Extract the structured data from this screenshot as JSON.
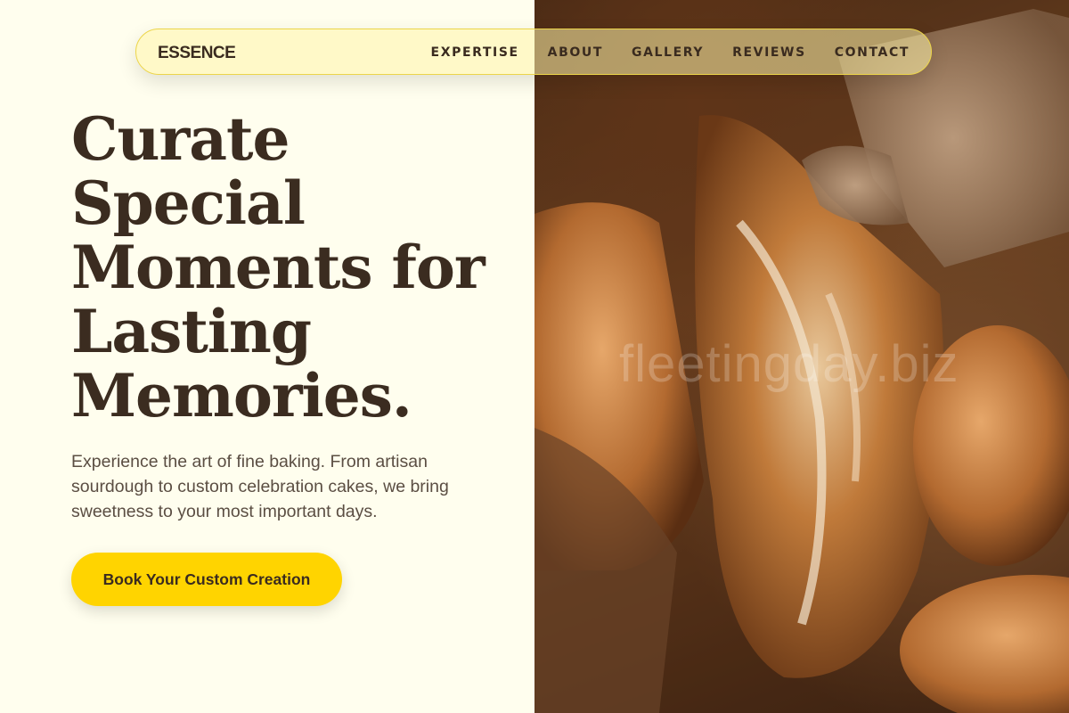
{
  "brand": {
    "name": "ESSENCE"
  },
  "nav": {
    "items": [
      {
        "label": "EXPERTISE"
      },
      {
        "label": "ABOUT"
      },
      {
        "label": "GALLERY"
      },
      {
        "label": "REVIEWS"
      },
      {
        "label": "CONTACT"
      }
    ]
  },
  "hero": {
    "title_lines": [
      "Curate",
      "Special",
      "Moments for",
      "Lasting",
      "Memories."
    ],
    "description": "Experience the art of fine baking. From artisan sourdough to custom celebration cakes, we bring sweetness to your most important days.",
    "cta_label": "Book Your Custom Creation"
  },
  "media": {
    "subject": "artisan bread loaves",
    "watermark": "fleetingday.biz"
  },
  "colors": {
    "page_background": "#fffeee",
    "accent_yellow": "#ffd400",
    "heading_brown": "#3b2c20",
    "body_text": "#5b4e43"
  }
}
